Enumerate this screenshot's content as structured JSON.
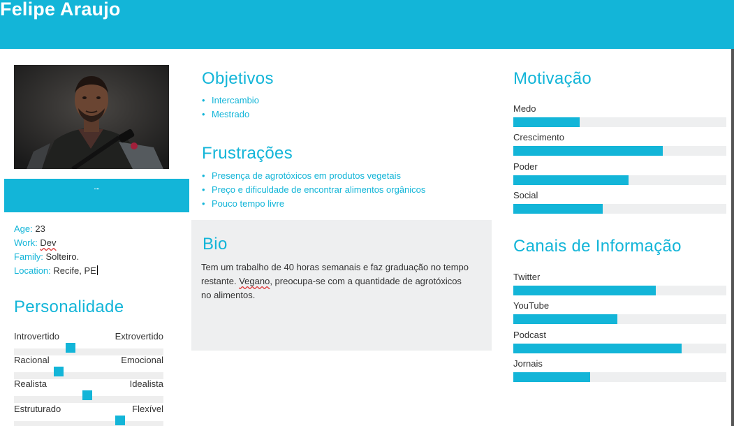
{
  "persona": {
    "name": "Felipe Araujo"
  },
  "quote": "\"\"",
  "info": [
    {
      "key": "Age:",
      "value": "23"
    },
    {
      "key": "Work:",
      "value": "Dev"
    },
    {
      "key": "Family:",
      "value": "Solteiro."
    },
    {
      "key": "Location:",
      "value": "Recife, PE"
    }
  ],
  "personality": {
    "title": "Personalidade",
    "traits": [
      {
        "left": "Introvertido",
        "right": "Extrovertido",
        "position": 0.38
      },
      {
        "left": "Racional",
        "right": "Emocional",
        "position": 0.3
      },
      {
        "left": "Realista",
        "right": "Idealista",
        "position": 0.49
      },
      {
        "left": "Estruturado",
        "right": "Flexível",
        "position": 0.71
      }
    ]
  },
  "objectives": {
    "title": "Objetivos",
    "items": [
      "Intercambio",
      "Mestrado"
    ]
  },
  "frustrations": {
    "title": "Frustrações",
    "items": [
      "Presença de agrotóxicos em produtos vegetais",
      "Preço e dificuldade de encontrar alimentos orgânicos",
      "Pouco tempo livre"
    ]
  },
  "bio": {
    "title": "Bio",
    "text_before": "Tem um trabalho de 40 horas semanais e faz graduação no tempo restante. ",
    "text_flagged": "Vegano",
    "text_after": ", preocupa-se com a quantidade de agrotóxicos no alimentos."
  },
  "motivation": {
    "title": "Motivação",
    "items": [
      {
        "label": "Medo",
        "level": 0.31
      },
      {
        "label": "Crescimento",
        "level": 0.7
      },
      {
        "label": "Poder",
        "level": 0.54
      },
      {
        "label": "Social",
        "level": 0.42
      }
    ]
  },
  "channels": {
    "title": "Canais de Informação",
    "items": [
      {
        "label": "Twitter",
        "level": 0.67
      },
      {
        "label": "YouTube",
        "level": 0.49
      },
      {
        "label": "Podcast",
        "level": 0.79
      },
      {
        "label": "Jornais",
        "level": 0.36
      }
    ]
  },
  "colors": {
    "accent": "#13b5d8",
    "panel": "#eeeff0",
    "text": "#333333"
  }
}
